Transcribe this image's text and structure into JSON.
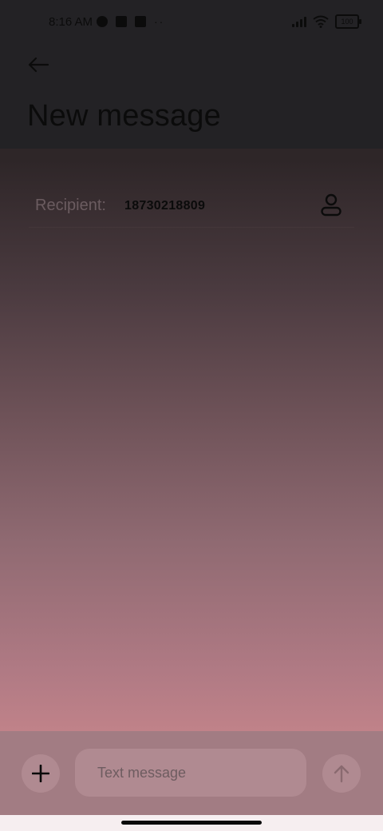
{
  "status_bar": {
    "time": "8:16 AM",
    "battery": "100",
    "icons": [
      "notification-circle-icon",
      "app-square-icon",
      "app-question-icon",
      "more-dots-icon"
    ]
  },
  "header": {
    "back_icon": "arrow-left-icon",
    "title": "New message"
  },
  "recipient": {
    "label": "Recipient:",
    "value": "18730218809",
    "contact_icon": "person-icon"
  },
  "composer": {
    "add_icon": "plus-icon",
    "placeholder": "Text message",
    "send_icon": "arrow-up-icon"
  },
  "colors": {
    "top_band": "#232225",
    "composer_bg": "#a27c83",
    "button_bg": "#b08a91",
    "gradient_bottom": "#c08289"
  }
}
